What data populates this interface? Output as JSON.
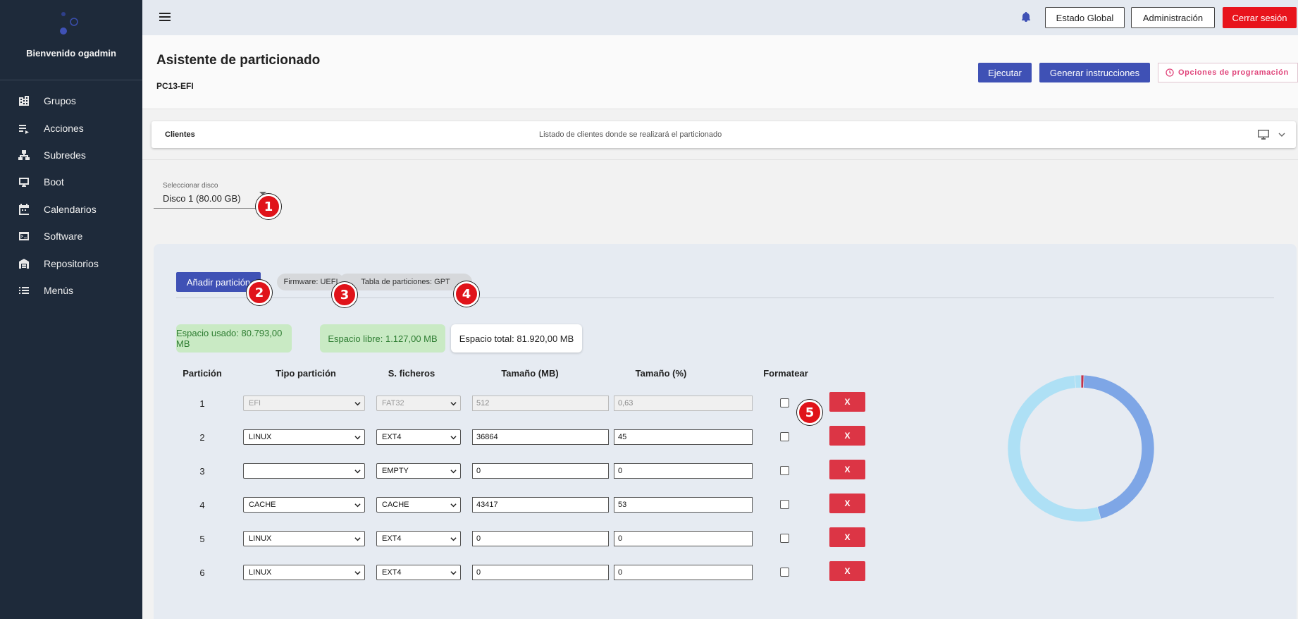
{
  "sidebar": {
    "welcome": "Bienvenido ogadmin",
    "items": [
      {
        "label": "Grupos",
        "icon": "building-icon"
      },
      {
        "label": "Acciones",
        "icon": "playlist-icon"
      },
      {
        "label": "Subredes",
        "icon": "network-icon"
      },
      {
        "label": "Boot",
        "icon": "monitor-icon"
      },
      {
        "label": "Calendarios",
        "icon": "calendar-icon"
      },
      {
        "label": "Software",
        "icon": "terminal-icon"
      },
      {
        "label": "Repositorios",
        "icon": "warehouse-icon"
      },
      {
        "label": "Menús",
        "icon": "list-icon"
      }
    ]
  },
  "topbar": {
    "estado_global": "Estado Global",
    "administracion": "Administración",
    "logout": "Cerrar sesión"
  },
  "header": {
    "title": "Asistente de particionado",
    "subtitle": "PC13-EFI",
    "ejecutar": "Ejecutar",
    "generar": "Generar instrucciones",
    "programacion": "Opciones de programación"
  },
  "clients": {
    "title": "Clientes",
    "description": "Listado de clientes donde se realizará el particionado"
  },
  "disk": {
    "label": "Seleccionar disco",
    "value": "Disco 1 (80.00 GB)"
  },
  "markers": [
    "1",
    "2",
    "3",
    "4",
    "5"
  ],
  "panel": {
    "add_button": "Añadir partición",
    "firmware": "Firmware: UEFI",
    "partition_table": "Tabla de particiones: GPT",
    "space_used": "Espacio usado: 80.793,00 MB",
    "space_free": "Espacio libre: 1.127,00 MB",
    "space_total": "Espacio total: 81.920,00 MB"
  },
  "table": {
    "headers": [
      "Partición",
      "Tipo partición",
      "S. ficheros",
      "Tamaño (MB)",
      "Tamaño (%)",
      "Formatear"
    ],
    "delete_label": "X",
    "rows": [
      {
        "num": "1",
        "type": "EFI",
        "fs": "FAT32",
        "size_mb": "512",
        "size_pct": "0,63",
        "disabled": true
      },
      {
        "num": "2",
        "type": "LINUX",
        "fs": "EXT4",
        "size_mb": "36864",
        "size_pct": "45",
        "disabled": false
      },
      {
        "num": "3",
        "type": "",
        "fs": "EMPTY",
        "size_mb": "0",
        "size_pct": "0",
        "disabled": false
      },
      {
        "num": "4",
        "type": "CACHE",
        "fs": "CACHE",
        "size_mb": "43417",
        "size_pct": "53",
        "disabled": false
      },
      {
        "num": "5",
        "type": "LINUX",
        "fs": "EXT4",
        "size_mb": "0",
        "size_pct": "0",
        "disabled": false
      },
      {
        "num": "6",
        "type": "LINUX",
        "fs": "EXT4",
        "size_mb": "0",
        "size_pct": "0",
        "disabled": false
      }
    ]
  },
  "chart_data": {
    "type": "pie",
    "values": [
      0.63,
      45,
      53,
      1.37
    ],
    "colors": [
      "#c0334d",
      "#7ea6e6",
      "#aee0f5",
      "#aee0f5"
    ]
  },
  "colors": {
    "sidebar_bg": "#1e2a3a",
    "primary": "#3f51b5",
    "danger": "#dc3545",
    "logout": "#e8141c"
  }
}
